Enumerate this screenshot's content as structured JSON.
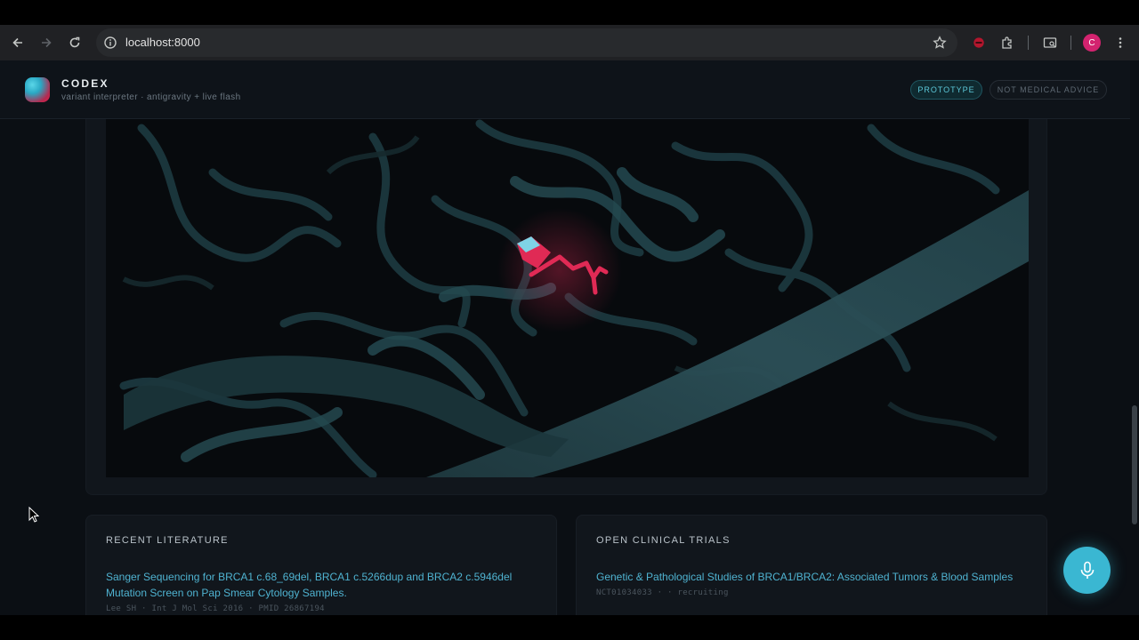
{
  "browser": {
    "url": "localhost:8000",
    "profile_initial": "C",
    "icons": [
      "back-icon",
      "forward-icon",
      "reload-icon",
      "site-info-icon",
      "bookmark-star-icon",
      "extension-blocker-icon",
      "extensions-puzzle-icon",
      "tab-search-icon",
      "profile-avatar",
      "menu-kebab-icon"
    ]
  },
  "app": {
    "brand": "CODEX",
    "tagline": "variant interpreter · antigravity + live flash",
    "badges": {
      "prototype": "PROTOTYPE",
      "advice": "NOT MEDICAL ADVICE"
    },
    "structure": {
      "description_icon": "protein-structure-viewer",
      "colors": {
        "ribbon": "#24474f",
        "ligand": "#e02a55",
        "ligand_tip": "#7fd3e6"
      }
    },
    "literature": {
      "heading": "RECENT LITERATURE",
      "items": [
        {
          "title": "Sanger Sequencing for BRCA1 c.68_69del, BRCA1 c.5266dup and BRCA2 c.5946del Mutation Screen on Pap Smear Cytology Samples.",
          "meta": "Lee SH · Int J Mol Sci 2016 · PMID 26867194"
        }
      ]
    },
    "trials": {
      "heading": "OPEN CLINICAL TRIALS",
      "items": [
        {
          "title": "Genetic & Pathological Studies of BRCA1/BRCA2: Associated Tumors & Blood Samples",
          "meta": "NCT01034033 · · recruiting"
        }
      ]
    },
    "mic_icon": "microphone-icon",
    "accent": "#3ab7d2"
  }
}
